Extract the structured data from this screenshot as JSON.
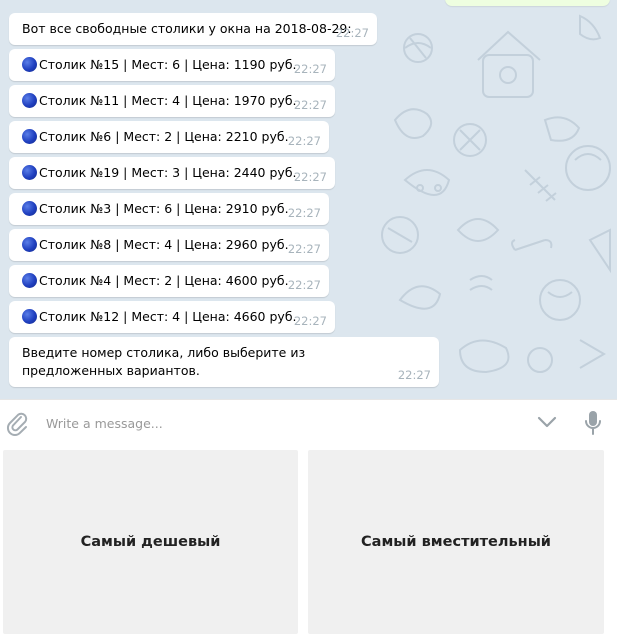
{
  "chat": {
    "intro": {
      "text": "Вот все свободные столики у окна на 2018-08-29:",
      "time": "22:27"
    },
    "tables": [
      {
        "text": "Столик №15 | Мест: 6 | Цена: 1190 руб.",
        "time": "22:27"
      },
      {
        "text": "Столик №11 | Мест: 4 | Цена: 1970 руб.",
        "time": "22:27"
      },
      {
        "text": "Столик №6 | Мест: 2 | Цена: 2210 руб.",
        "time": "22:27"
      },
      {
        "text": "Столик №19 | Мест: 3 | Цена: 2440 руб.",
        "time": "22:27"
      },
      {
        "text": "Столик №3 | Мест: 6 | Цена: 2910 руб.",
        "time": "22:27"
      },
      {
        "text": "Столик №8 | Мест: 4 | Цена: 2960 руб.",
        "time": "22:27"
      },
      {
        "text": "Столик №4 | Мест: 2 | Цена: 4600 руб.",
        "time": "22:27"
      },
      {
        "text": "Столик №12 | Мест: 4 | Цена: 4660 руб.",
        "time": "22:27"
      }
    ],
    "prompt": {
      "text": "Введите номер столика, либо выберите из предложенных вариантов.",
      "time": "22:27"
    }
  },
  "composer": {
    "placeholder": "Write a message...",
    "attach_icon": "paperclip-icon",
    "keyboard_toggle_icon": "chevron-down-icon",
    "voice_icon": "microphone-icon"
  },
  "keyboard": {
    "cheapest": "Самый дешевый",
    "roomiest": "Самый вместительный"
  },
  "colors": {
    "chat_bg": "#dce6ee",
    "bubble": "#ffffff",
    "time": "#a8b4bc",
    "button_bg": "#f0f0f0",
    "dot": "#1f3fbf"
  }
}
